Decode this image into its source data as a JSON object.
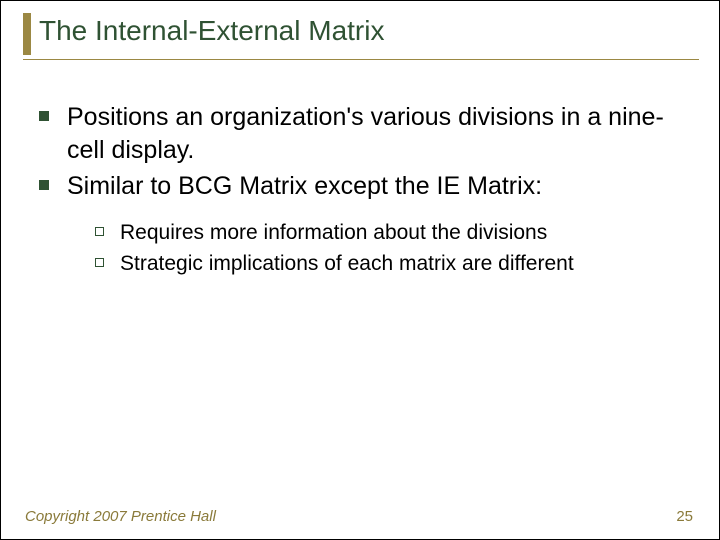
{
  "title": "The Internal-External Matrix",
  "bullets": [
    {
      "text": "Positions an organization's various divisions in a nine-cell display."
    },
    {
      "text": "Similar to BCG Matrix except the IE Matrix:"
    }
  ],
  "subbullets": [
    {
      "text": "Requires more information about the divisions"
    },
    {
      "text": "Strategic implications of each matrix are different"
    }
  ],
  "footer": {
    "copyright": "Copyright 2007 Prentice Hall",
    "page": "25"
  }
}
